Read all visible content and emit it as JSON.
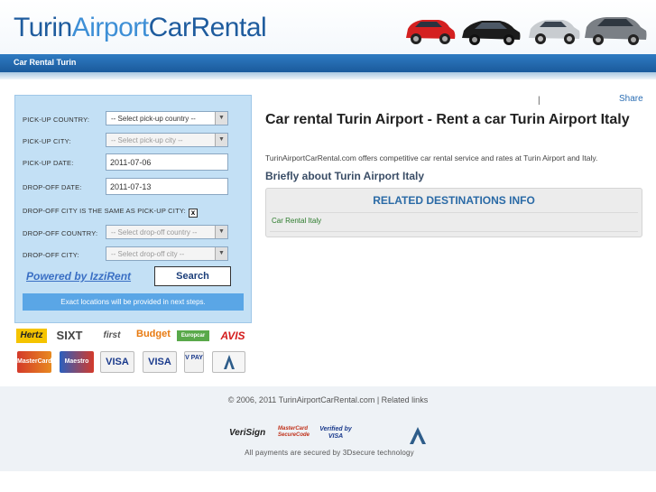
{
  "header": {
    "logo_part1": "Turin",
    "logo_part2": "Airport",
    "logo_part3": "CarRental",
    "nav_link": "Car Rental Turin"
  },
  "share": {
    "separator": "|",
    "label": "Share"
  },
  "form": {
    "pickup_country_label": "PICK-UP COUNTRY:",
    "pickup_country_value": "-- Select pick-up country --",
    "pickup_city_label": "PICK-UP CITY:",
    "pickup_city_value": "-- Select pick-up city --",
    "pickup_date_label": "PICK-UP DATE:",
    "pickup_date_value": "2011-07-06",
    "dropoff_date_label": "DROP-OFF DATE:",
    "dropoff_date_value": "2011-07-13",
    "same_city_label": "DROP-OFF CITY IS THE SAME AS PICK-UP CITY:",
    "same_city_checked": "x",
    "dropoff_country_label": "DROP-OFF COUNTRY:",
    "dropoff_country_value": "-- Select drop-off country --",
    "dropoff_city_label": "DROP-OFF CITY:",
    "dropoff_city_value": "-- Select drop-off city --",
    "powered_by": "Powered by IzziRent",
    "search_button": "Search",
    "location_info": "Exact locations will be provided in next steps."
  },
  "brands": {
    "hertz": "Hertz",
    "sixt": "SIXT",
    "first": "first",
    "budget": "Budget",
    "europcar": "Europcar",
    "avis": "AVIS"
  },
  "cards": {
    "mastercard": "MasterCard",
    "maestro": "Maestro",
    "visa": "VISA",
    "visa_electron": "VISA",
    "vpay": "V PAY"
  },
  "main": {
    "title": "Car rental Turin Airport - Rent a car Turin Airport Italy",
    "description": "TurinAirportCarRental.com offers competitive car rental service and rates at Turin Airport and Italy.",
    "briefly": "Briefly about Turin Airport Italy",
    "related_title": "RELATED DESTINATIONS INFO",
    "related_link": "Car Rental Italy"
  },
  "footer": {
    "copyright": "© 2006, 2011 TurinAirportCarRental.com | Related links",
    "verisign": "VeriSign",
    "mastercard_secure": "MasterCard SecureCode",
    "verified_visa": "Verified by VISA",
    "secure_text": "All payments are secured by 3Dsecure technology"
  },
  "colors": {
    "brand_blue": "#1f5c9e",
    "brand_light_blue": "#3e8fd6",
    "form_bg": "#c3e0f5",
    "info_bar": "#5aa6e6"
  }
}
